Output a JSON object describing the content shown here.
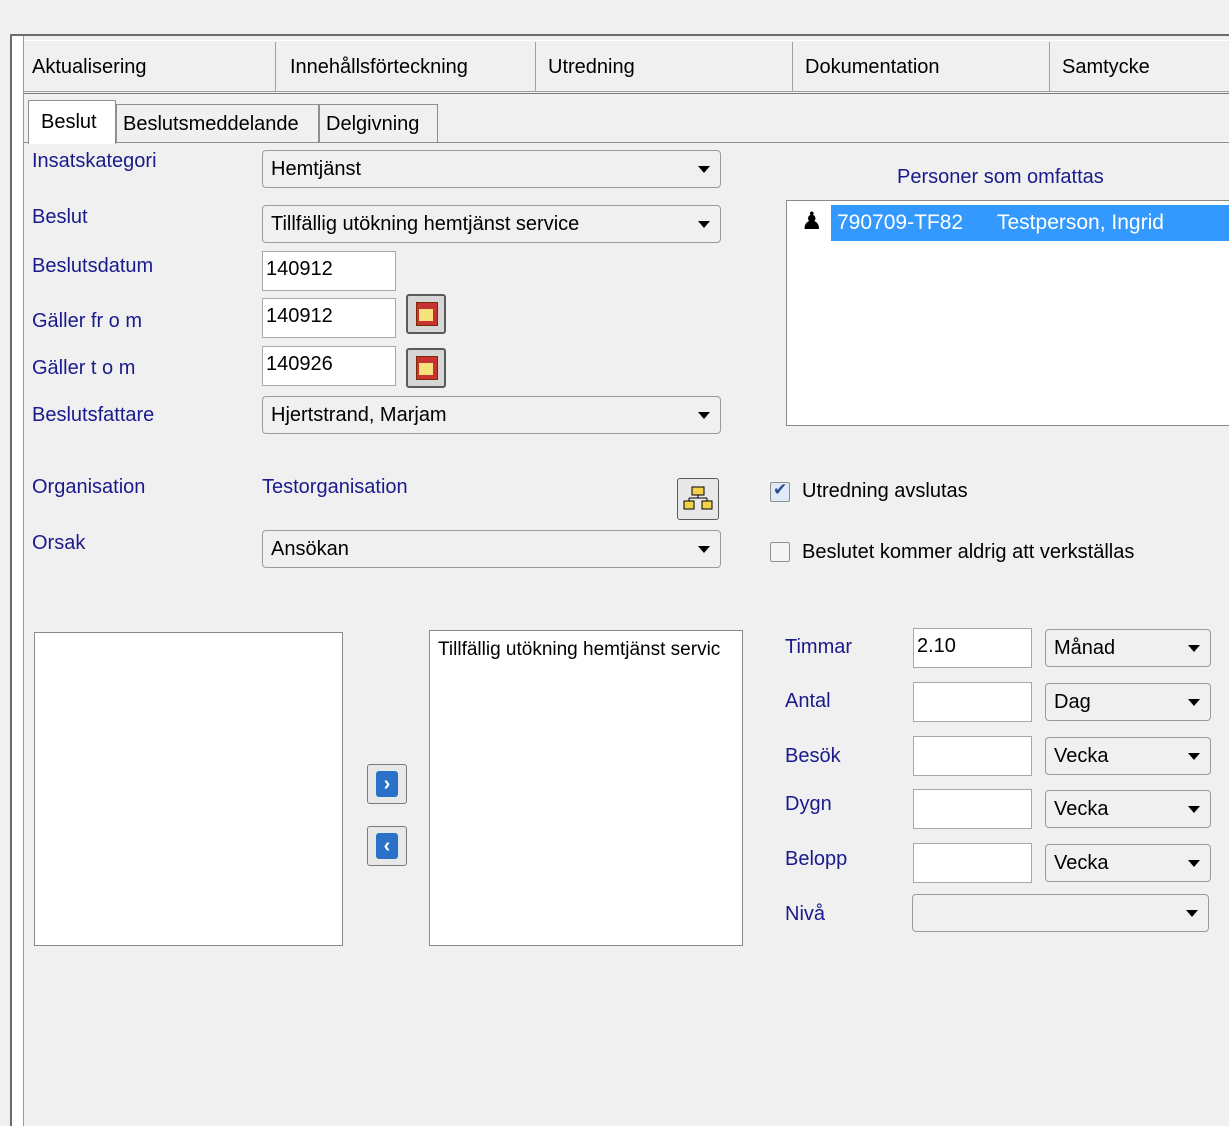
{
  "main_tabs": [
    "Aktualisering",
    "Innehållsförteckning",
    "Utredning",
    "Dokumentation",
    "Samtycke"
  ],
  "sub_tabs": [
    "Beslut",
    "Beslutsmeddelande",
    "Delgivning"
  ],
  "form": {
    "insatskategori": {
      "label": "Insatskategori",
      "value": "Hemtjänst"
    },
    "beslut": {
      "label": "Beslut",
      "value": "Tillfällig utökning hemtjänst service"
    },
    "beslutsdatum": {
      "label": "Beslutsdatum",
      "value": "140912"
    },
    "galler_from": {
      "label": "Gäller fr o m",
      "value": "140912"
    },
    "galler_tom": {
      "label": "Gäller t o m",
      "value": "140926"
    },
    "beslutsfattare": {
      "label": "Beslutsfattare",
      "value": "Hjertstrand, Marjam"
    },
    "organisation": {
      "label": "Organisation",
      "value": "Testorganisation"
    },
    "orsak": {
      "label": "Orsak",
      "value": "Ansökan"
    }
  },
  "persons": {
    "heading": "Personer som omfattas",
    "rows": [
      {
        "id": "790709-TF82",
        "name": "Testperson, Ingrid"
      }
    ]
  },
  "checkboxes": {
    "utredning_avslutas": {
      "label": "Utredning avslutas",
      "checked": true
    },
    "aldrig_verkstallas": {
      "label": "Beslutet kommer aldrig att verkställas",
      "checked": false
    }
  },
  "selected_list": {
    "items": [
      "Tillfällig utökning hemtjänst servic"
    ]
  },
  "quantities": [
    {
      "label": "Timmar",
      "value": "2.10",
      "unit": "Månad"
    },
    {
      "label": "Antal",
      "value": "",
      "unit": "Dag"
    },
    {
      "label": "Besök",
      "value": "",
      "unit": "Vecka"
    },
    {
      "label": "Dygn",
      "value": "",
      "unit": "Vecka"
    },
    {
      "label": "Belopp",
      "value": "",
      "unit": "Vecka"
    }
  ],
  "niva": {
    "label": "Nivå",
    "value": ""
  },
  "icons": {
    "nav_right": "›",
    "nav_left": "‹",
    "person": "♟"
  }
}
